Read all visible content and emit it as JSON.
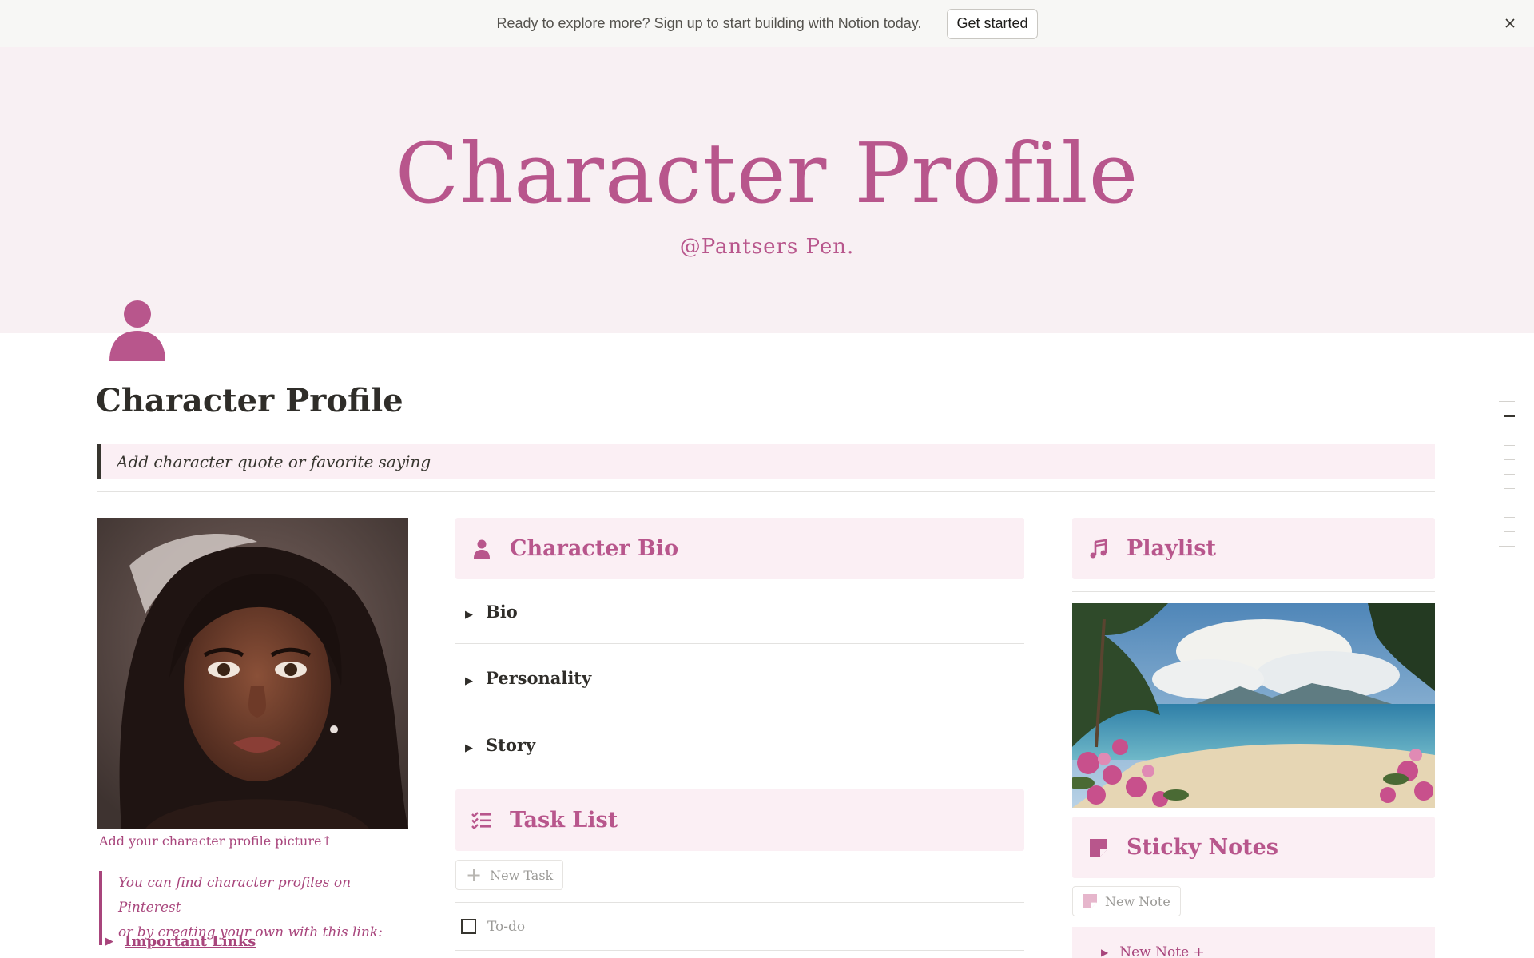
{
  "banner": {
    "text": "Ready to explore more? Sign up to start building with Notion today.",
    "button_label": "Get started",
    "close_icon": "close-icon"
  },
  "cover": {
    "title": "Character Profile",
    "subtitle": "@Pantsers Pen."
  },
  "page": {
    "icon": "person-icon",
    "title": "Character Profile",
    "quote": "Add character quote or favorite saying"
  },
  "left": {
    "caption": "Add your character profile picture↑",
    "callout_line1": "You can find character profiles on Pinterest",
    "callout_line2": "or by creating your own with this link:",
    "links_label": "Important Links"
  },
  "bio": {
    "header": "Character Bio",
    "toggles": [
      "Bio",
      "Personality",
      "Story"
    ]
  },
  "tasks": {
    "header": "Task List",
    "new_label": "New Task",
    "todo_label": "To-do"
  },
  "playlist": {
    "header": "Playlist"
  },
  "sticky": {
    "header": "Sticky Notes",
    "new_label": "New Note",
    "toggle_label": "New Note +"
  },
  "colors": {
    "accent": "#b8568c",
    "accent_dark": "#a8457c",
    "cover_bg": "#f8f0f3",
    "header_bg": "#fbeff4"
  }
}
